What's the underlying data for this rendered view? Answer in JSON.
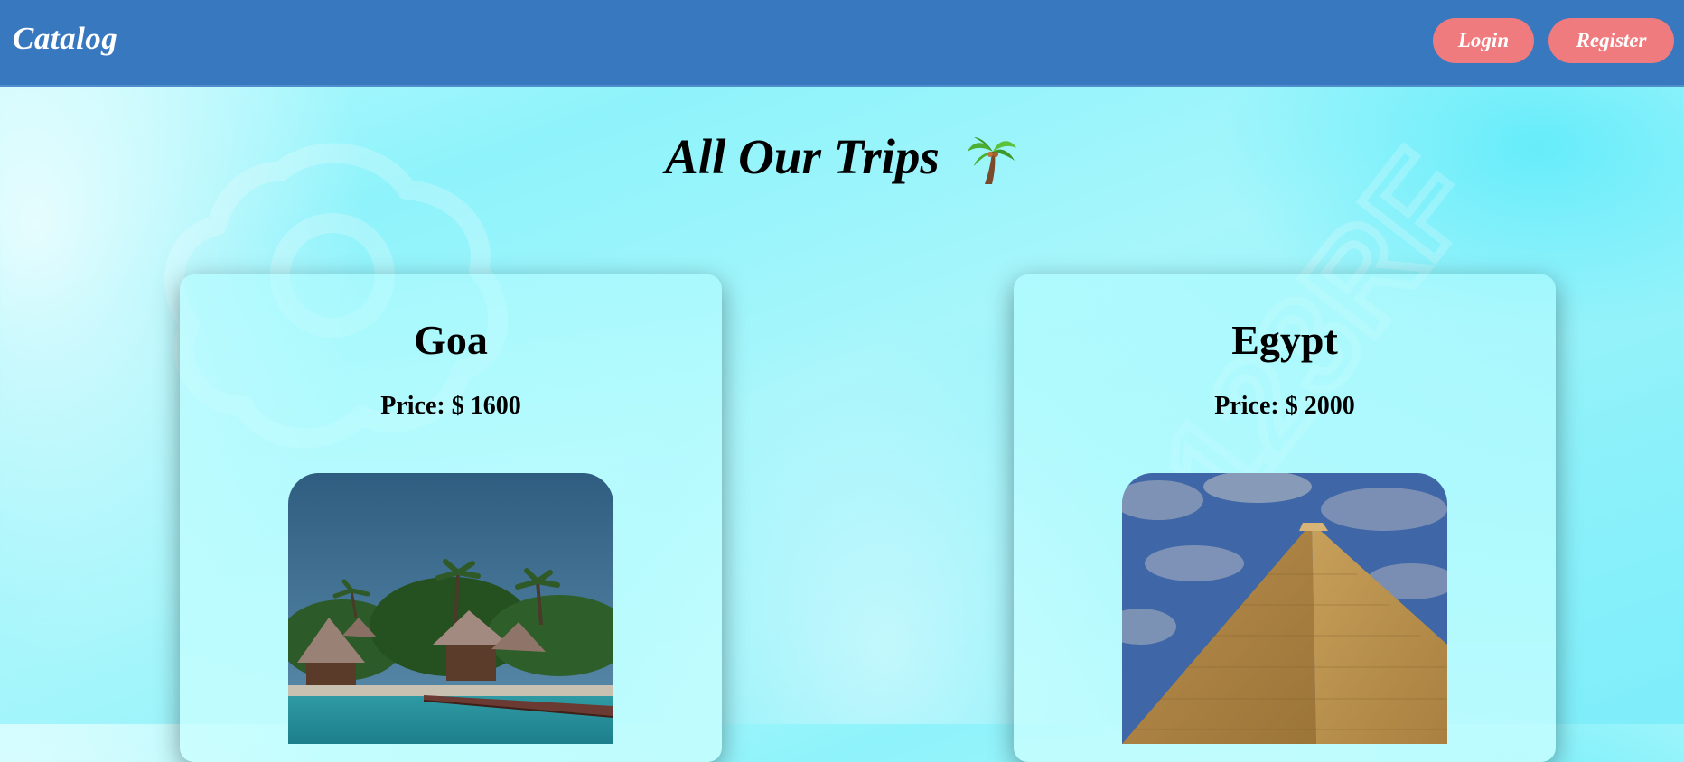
{
  "header": {
    "brand": "Catalog",
    "login_label": "Login",
    "register_label": "Register"
  },
  "main": {
    "title": "All Our Trips",
    "title_icon": "palm-tree-icon"
  },
  "trips": [
    {
      "name": "Goa",
      "price": "Price: $ 1600",
      "image": "tropical-resort-photo"
    },
    {
      "name": "Egypt",
      "price": "Price: $ 2000",
      "image": "pyramid-photo"
    }
  ],
  "colors": {
    "header_bg": "#3778be",
    "button_bg": "#ef7b7e",
    "page_bg": "#8ff3fb"
  },
  "watermark": {
    "text": "123RF"
  }
}
